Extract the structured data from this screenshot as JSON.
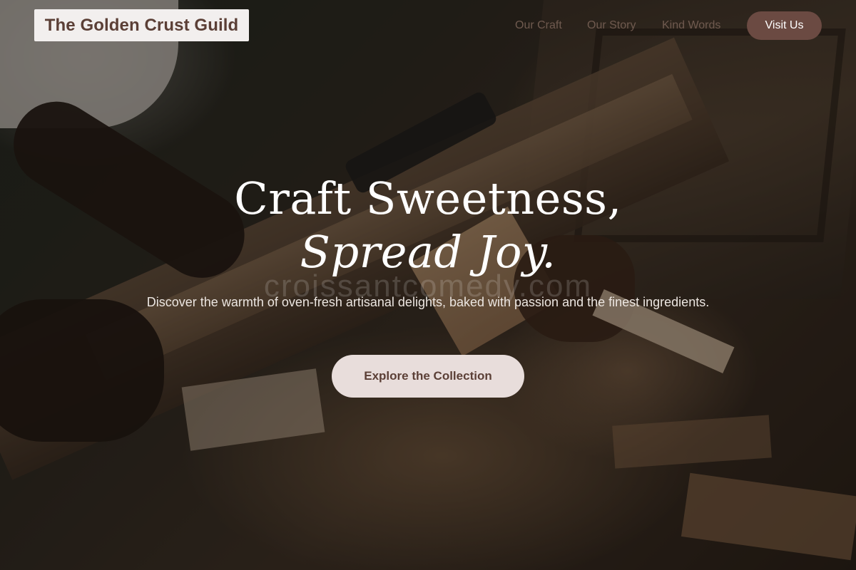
{
  "header": {
    "brand": "The Golden Crust Guild",
    "nav": [
      {
        "label": "Our Craft"
      },
      {
        "label": "Our Story"
      },
      {
        "label": "Kind Words"
      }
    ],
    "cta_label": "Visit Us"
  },
  "hero": {
    "headline_line1": "Craft Sweetness,",
    "headline_line2": "Spread Joy.",
    "watermark": "croissantcomedy.com",
    "subtitle": "Discover the warmth of oven-fresh artisanal delights, baked with passion and the finest ingredients.",
    "button_label": "Explore the Collection"
  },
  "colors": {
    "brand_text": "#5b3f36",
    "visit_button_bg": "#6b4a42",
    "cta_bg": "#e8dddb",
    "nav_text": "#6f5a4f"
  }
}
